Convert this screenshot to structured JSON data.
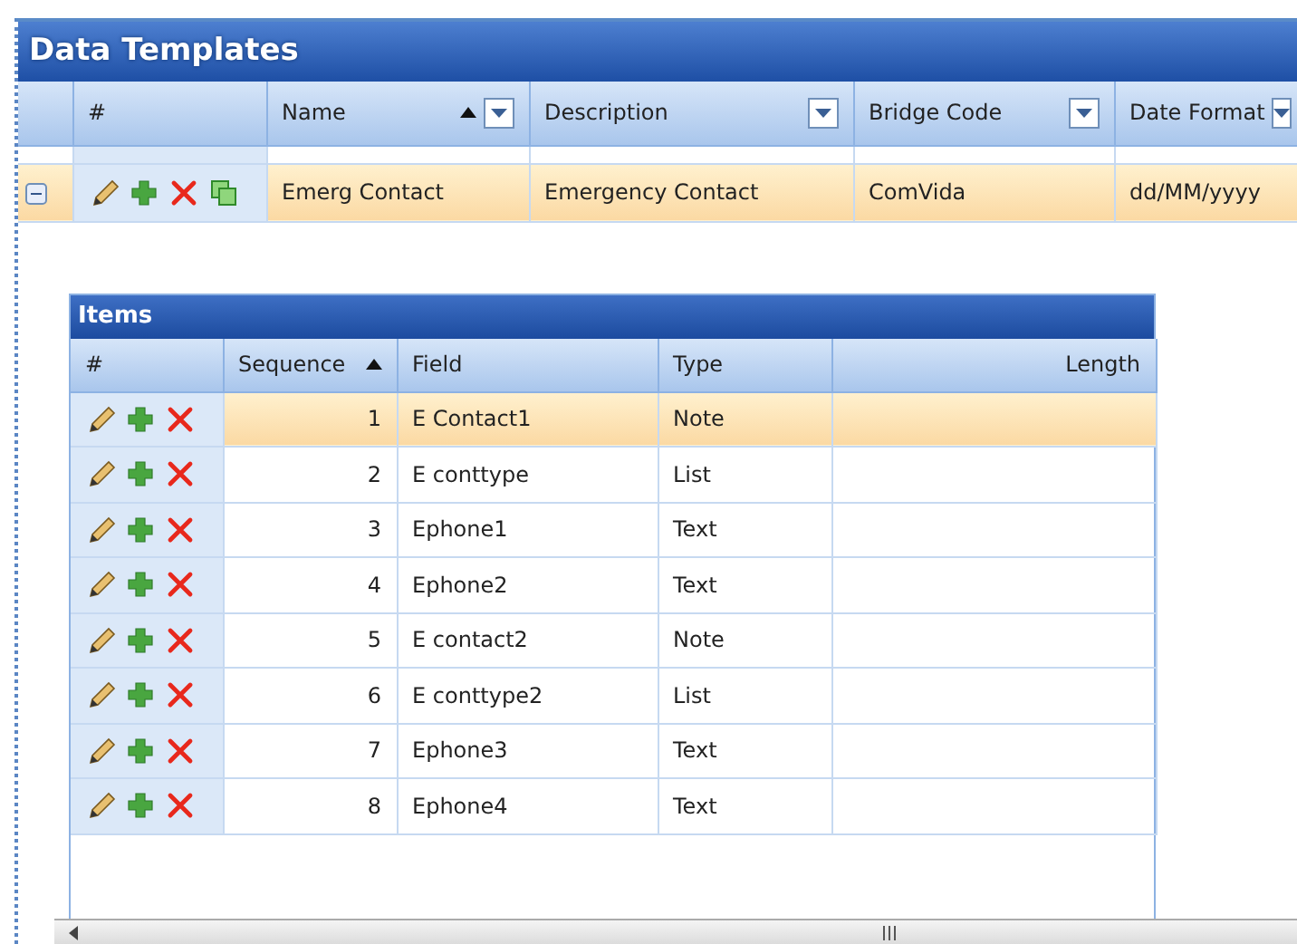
{
  "panel": {
    "title": "Data Templates"
  },
  "columns": [
    {
      "label": "#",
      "sorted": false,
      "filter": false
    },
    {
      "label": "Name",
      "sorted": true,
      "filter": true
    },
    {
      "label": "Description",
      "sorted": false,
      "filter": true
    },
    {
      "label": "Bridge Code",
      "sorted": false,
      "filter": true
    },
    {
      "label": "Date Format",
      "sorted": false,
      "filter": true
    }
  ],
  "rows": [
    {
      "expanded": true,
      "selected": true,
      "cells": [
        "",
        "Emerg Contact",
        "Emergency Contact",
        "ComVida",
        "dd/MM/yyyy"
      ]
    }
  ],
  "items": {
    "title": "Items",
    "columns": [
      {
        "label": "#",
        "sorted": false
      },
      {
        "label": "Sequence",
        "sorted": true
      },
      {
        "label": "Field",
        "sorted": false
      },
      {
        "label": "Type",
        "sorted": false
      },
      {
        "label": "Length",
        "sorted": false
      }
    ],
    "rows": [
      {
        "selected": true,
        "cells": [
          "",
          "1",
          "E Contact1",
          "Note",
          ""
        ]
      },
      {
        "selected": false,
        "cells": [
          "",
          "2",
          "E conttype",
          "List",
          ""
        ]
      },
      {
        "selected": false,
        "cells": [
          "",
          "3",
          "Ephone1",
          "Text",
          ""
        ]
      },
      {
        "selected": false,
        "cells": [
          "",
          "4",
          "Ephone2",
          "Text",
          ""
        ]
      },
      {
        "selected": false,
        "cells": [
          "",
          "5",
          "E contact2",
          "Note",
          ""
        ]
      },
      {
        "selected": false,
        "cells": [
          "",
          "6",
          "E conttype2",
          "List",
          ""
        ]
      },
      {
        "selected": false,
        "cells": [
          "",
          "7",
          "Ephone3",
          "Text",
          ""
        ]
      },
      {
        "selected": false,
        "cells": [
          "",
          "8",
          "Ephone4",
          "Text",
          ""
        ]
      }
    ]
  }
}
